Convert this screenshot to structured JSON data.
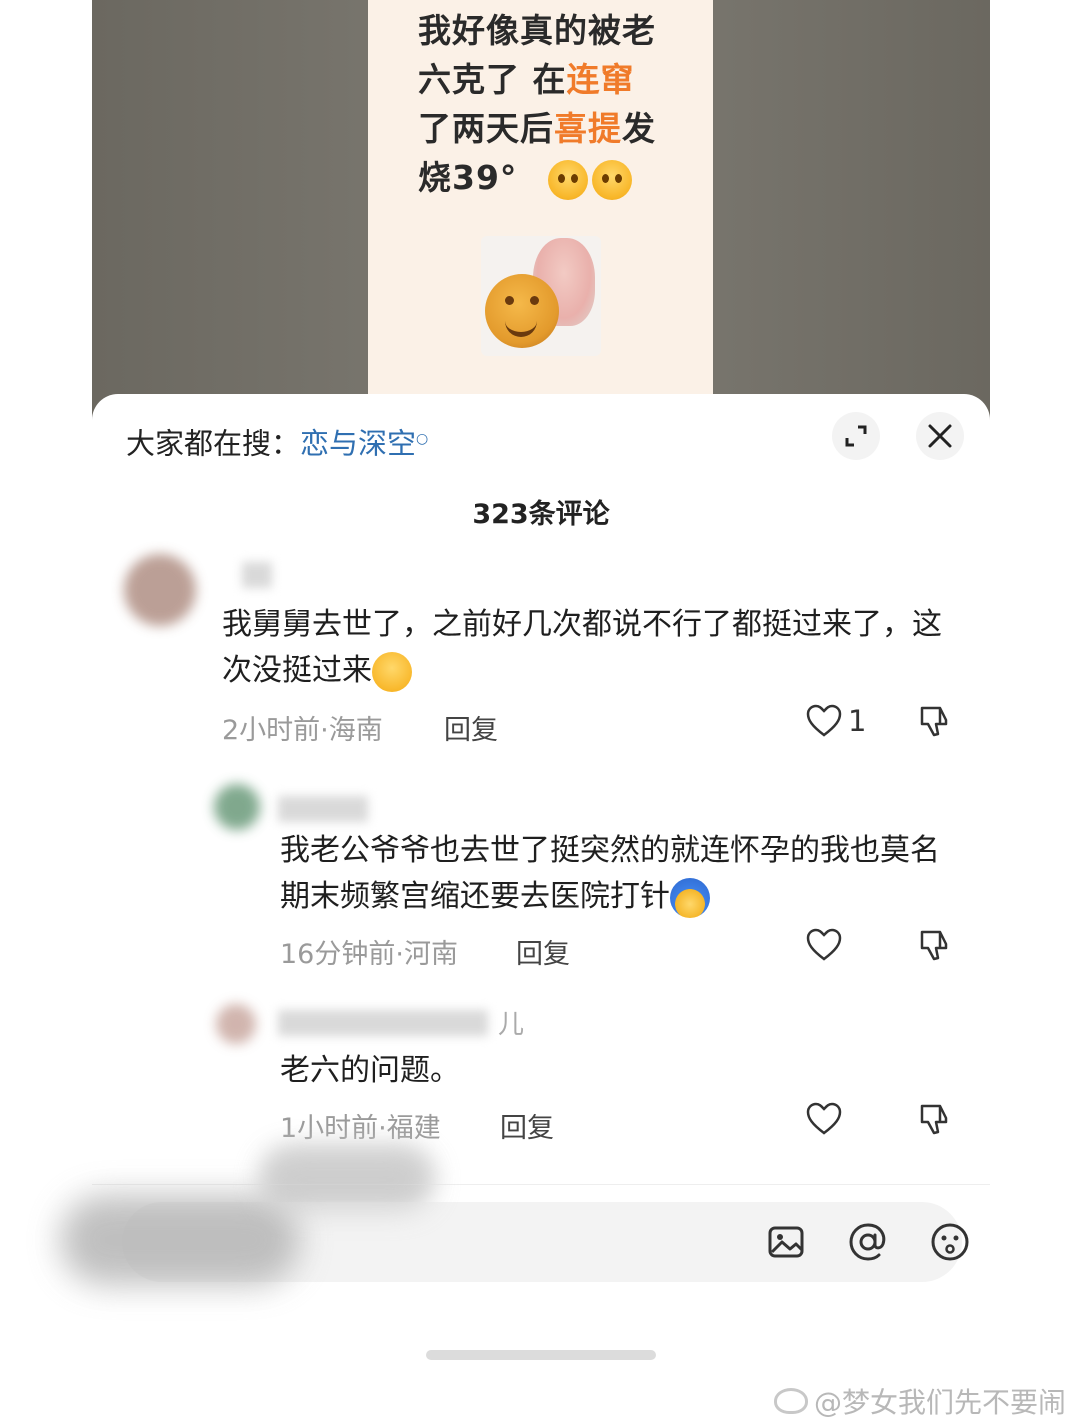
{
  "video": {
    "line1": "我好像真的被老",
    "line2a": "六克了 在",
    "line2b": "连窜",
    "line3a": "了两天后",
    "line3b": "喜提",
    "line3c": "发",
    "line4": "烧39°"
  },
  "sheet": {
    "search_prefix": "大家都在搜：",
    "search_term": "恋与深空",
    "comment_count": "323条评论"
  },
  "comments": [
    {
      "text": "我舅舅去世了，之前好几次都说不行了都挺过来了，这次没挺过来",
      "time_location": "2小时前·海南",
      "reply_label": "回复",
      "likes": "1"
    },
    {
      "text": "我老公爷爷也去世了挺突然的就连怀孕的我也莫名期末频繁宫缩还要去医院打针",
      "time_location": "16分钟前·河南",
      "reply_label": "回复",
      "likes": ""
    },
    {
      "name_tail": "儿",
      "text": "老六的问题。",
      "time_location": "1小时前·福建",
      "reply_label": "回复",
      "likes": ""
    }
  ],
  "watermark": "@梦女我们先不要闹",
  "icons": {
    "expand": "expand-icon",
    "close": "close-icon",
    "like": "heart-icon",
    "dislike": "thumbs-down-icon",
    "image": "image-icon",
    "mention": "at-icon",
    "emoji": "emoji-icon"
  },
  "colors": {
    "accent_orange": "#f07b2a",
    "link_blue": "#2f6fb1"
  }
}
